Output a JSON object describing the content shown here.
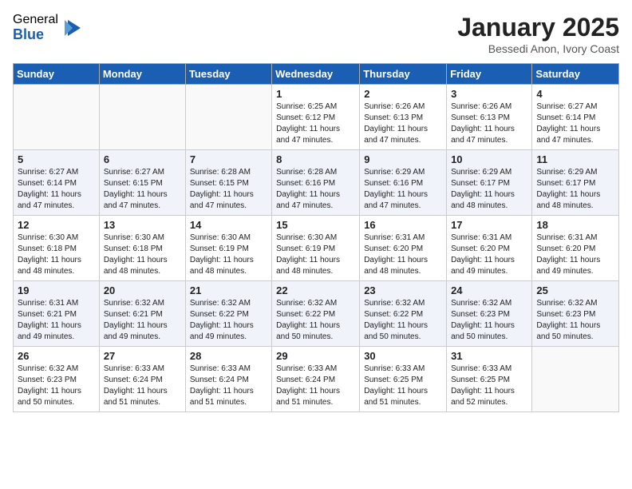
{
  "logo": {
    "general": "General",
    "blue": "Blue"
  },
  "title": "January 2025",
  "location": "Bessedi Anon, Ivory Coast",
  "weekdays": [
    "Sunday",
    "Monday",
    "Tuesday",
    "Wednesday",
    "Thursday",
    "Friday",
    "Saturday"
  ],
  "weeks": [
    [
      {
        "day": "",
        "info": ""
      },
      {
        "day": "",
        "info": ""
      },
      {
        "day": "",
        "info": ""
      },
      {
        "day": "1",
        "info": "Sunrise: 6:25 AM\nSunset: 6:12 PM\nDaylight: 11 hours and 47 minutes."
      },
      {
        "day": "2",
        "info": "Sunrise: 6:26 AM\nSunset: 6:13 PM\nDaylight: 11 hours and 47 minutes."
      },
      {
        "day": "3",
        "info": "Sunrise: 6:26 AM\nSunset: 6:13 PM\nDaylight: 11 hours and 47 minutes."
      },
      {
        "day": "4",
        "info": "Sunrise: 6:27 AM\nSunset: 6:14 PM\nDaylight: 11 hours and 47 minutes."
      }
    ],
    [
      {
        "day": "5",
        "info": "Sunrise: 6:27 AM\nSunset: 6:14 PM\nDaylight: 11 hours and 47 minutes."
      },
      {
        "day": "6",
        "info": "Sunrise: 6:27 AM\nSunset: 6:15 PM\nDaylight: 11 hours and 47 minutes."
      },
      {
        "day": "7",
        "info": "Sunrise: 6:28 AM\nSunset: 6:15 PM\nDaylight: 11 hours and 47 minutes."
      },
      {
        "day": "8",
        "info": "Sunrise: 6:28 AM\nSunset: 6:16 PM\nDaylight: 11 hours and 47 minutes."
      },
      {
        "day": "9",
        "info": "Sunrise: 6:29 AM\nSunset: 6:16 PM\nDaylight: 11 hours and 47 minutes."
      },
      {
        "day": "10",
        "info": "Sunrise: 6:29 AM\nSunset: 6:17 PM\nDaylight: 11 hours and 48 minutes."
      },
      {
        "day": "11",
        "info": "Sunrise: 6:29 AM\nSunset: 6:17 PM\nDaylight: 11 hours and 48 minutes."
      }
    ],
    [
      {
        "day": "12",
        "info": "Sunrise: 6:30 AM\nSunset: 6:18 PM\nDaylight: 11 hours and 48 minutes."
      },
      {
        "day": "13",
        "info": "Sunrise: 6:30 AM\nSunset: 6:18 PM\nDaylight: 11 hours and 48 minutes."
      },
      {
        "day": "14",
        "info": "Sunrise: 6:30 AM\nSunset: 6:19 PM\nDaylight: 11 hours and 48 minutes."
      },
      {
        "day": "15",
        "info": "Sunrise: 6:30 AM\nSunset: 6:19 PM\nDaylight: 11 hours and 48 minutes."
      },
      {
        "day": "16",
        "info": "Sunrise: 6:31 AM\nSunset: 6:20 PM\nDaylight: 11 hours and 48 minutes."
      },
      {
        "day": "17",
        "info": "Sunrise: 6:31 AM\nSunset: 6:20 PM\nDaylight: 11 hours and 49 minutes."
      },
      {
        "day": "18",
        "info": "Sunrise: 6:31 AM\nSunset: 6:20 PM\nDaylight: 11 hours and 49 minutes."
      }
    ],
    [
      {
        "day": "19",
        "info": "Sunrise: 6:31 AM\nSunset: 6:21 PM\nDaylight: 11 hours and 49 minutes."
      },
      {
        "day": "20",
        "info": "Sunrise: 6:32 AM\nSunset: 6:21 PM\nDaylight: 11 hours and 49 minutes."
      },
      {
        "day": "21",
        "info": "Sunrise: 6:32 AM\nSunset: 6:22 PM\nDaylight: 11 hours and 49 minutes."
      },
      {
        "day": "22",
        "info": "Sunrise: 6:32 AM\nSunset: 6:22 PM\nDaylight: 11 hours and 50 minutes."
      },
      {
        "day": "23",
        "info": "Sunrise: 6:32 AM\nSunset: 6:22 PM\nDaylight: 11 hours and 50 minutes."
      },
      {
        "day": "24",
        "info": "Sunrise: 6:32 AM\nSunset: 6:23 PM\nDaylight: 11 hours and 50 minutes."
      },
      {
        "day": "25",
        "info": "Sunrise: 6:32 AM\nSunset: 6:23 PM\nDaylight: 11 hours and 50 minutes."
      }
    ],
    [
      {
        "day": "26",
        "info": "Sunrise: 6:32 AM\nSunset: 6:23 PM\nDaylight: 11 hours and 50 minutes."
      },
      {
        "day": "27",
        "info": "Sunrise: 6:33 AM\nSunset: 6:24 PM\nDaylight: 11 hours and 51 minutes."
      },
      {
        "day": "28",
        "info": "Sunrise: 6:33 AM\nSunset: 6:24 PM\nDaylight: 11 hours and 51 minutes."
      },
      {
        "day": "29",
        "info": "Sunrise: 6:33 AM\nSunset: 6:24 PM\nDaylight: 11 hours and 51 minutes."
      },
      {
        "day": "30",
        "info": "Sunrise: 6:33 AM\nSunset: 6:25 PM\nDaylight: 11 hours and 51 minutes."
      },
      {
        "day": "31",
        "info": "Sunrise: 6:33 AM\nSunset: 6:25 PM\nDaylight: 11 hours and 52 minutes."
      },
      {
        "day": "",
        "info": ""
      }
    ]
  ]
}
